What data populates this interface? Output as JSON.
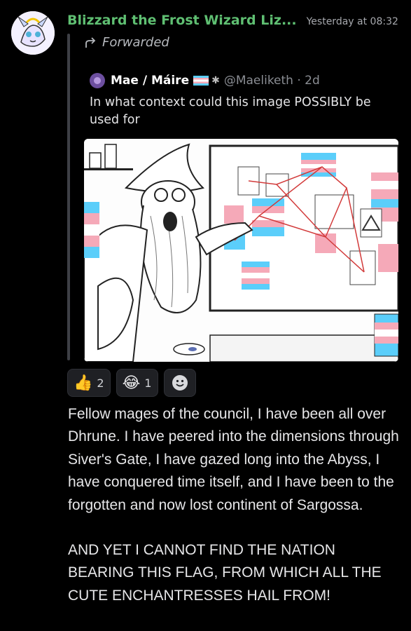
{
  "message": {
    "author": "Blizzard the Frost Wizard Liz...",
    "timestamp": "Yesterday at 08:32",
    "author_color": "#5fbf72",
    "forwarded_label": "Forwarded"
  },
  "tweet": {
    "name": "Mae / Máire",
    "handle": "@Maeliketh · 2d",
    "text": "In what context could this image POSSIBLY be used for"
  },
  "reactions": [
    {
      "emoji": "👍",
      "icon": "thumbs-up-icon",
      "count": "2"
    },
    {
      "emoji": "😂",
      "icon": "tears-of-joy-icon",
      "count": "1"
    },
    {
      "icon": "add-reaction-icon"
    }
  ],
  "body": {
    "paragraph1": "Fellow mages of the council, I have been all over Dhrune. I have peered into the dimensions through Siver's Gate, I have gazed long into the Abyss, I have conquered time itself, and I have been to the forgotten and now lost continent of Sargossa.",
    "paragraph2": "AND YET I CANNOT FIND THE NATION BEARING THIS FLAG, FROM WHICH ALL THE CUTE ENCHANTRESSES HAIL FROM!"
  },
  "colors": {
    "background": "#000000",
    "trans_blue": "#5bcefa",
    "trans_pink": "#f5a9b8",
    "trans_white": "#ffffff"
  }
}
